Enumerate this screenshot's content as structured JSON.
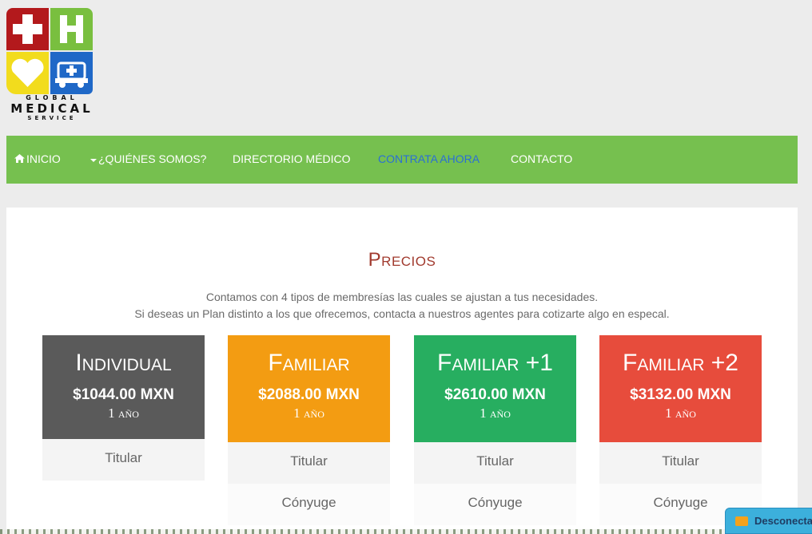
{
  "logo": {
    "line1": "GLOBAL",
    "line2": "MEDICAL",
    "line3": "SERVICE",
    "icons": [
      "cross-icon",
      "h-letter-icon",
      "heart-icon",
      "ambulance-icon"
    ],
    "colors": {
      "red": "#b3191c",
      "green": "#79bf3f",
      "yellow": "#f2dc1d",
      "blue": "#1f68c7"
    }
  },
  "nav": {
    "items": [
      {
        "label": "INICIO",
        "icon": "home-icon"
      },
      {
        "label": "¿QUIÉNES SOMOS?",
        "icon": "caret-down-icon"
      },
      {
        "label": "DIRECTORIO MÉDICO"
      },
      {
        "label": "CONTRATA AHORA",
        "active": true
      },
      {
        "label": "CONTACTO"
      }
    ],
    "background": "#76c04f"
  },
  "pricing": {
    "title": "Precios",
    "intro_line1": "Contamos con 4 tipos de membresías las cuales se ajustan a tus necesidades.",
    "intro_line2": "Si deseas un Plan distinto a los que ofrecemos, contacta a nuestros agentes para cotizarte algo en especal.",
    "plans": [
      {
        "name": "Individual",
        "price": "$1044.00 MXN",
        "period": "1 año",
        "color": "#5a5a5a",
        "rows": [
          "Titular"
        ]
      },
      {
        "name": "Familiar",
        "price": "$2088.00 MXN",
        "period": "1 año",
        "color": "#f39c12",
        "rows": [
          "Titular",
          "Cónyuge"
        ]
      },
      {
        "name": "Familiar +1",
        "price": "$2610.00 MXN",
        "period": "1 año",
        "color": "#27ae60",
        "rows": [
          "Titular",
          "Cónyuge"
        ]
      },
      {
        "name": "Familiar +2",
        "price": "$3132.00 MXN",
        "period": "1 año",
        "color": "#e74c3c",
        "rows": [
          "Titular",
          "Cónyuge"
        ]
      }
    ]
  },
  "chat": {
    "label": "Desconectado",
    "icon": "envelope-icon"
  }
}
